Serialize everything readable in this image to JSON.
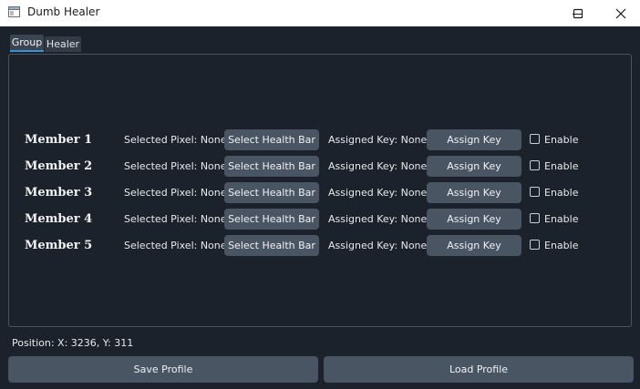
{
  "window": {
    "title": "Dumb Healer",
    "icon": "app-window-icon",
    "controls": [
      "minimize-icon",
      "maximize-icon",
      "close-icon"
    ]
  },
  "tabs": [
    {
      "label": "Group",
      "selected": true
    },
    {
      "label": "Healer",
      "selected": false
    }
  ],
  "members": [
    {
      "label": "Member 1",
      "pixel": "Selected Pixel: None",
      "select_label": "Select Health Bar",
      "key": "Assigned Key: None",
      "assign_label": "Assign Key",
      "enable_label": "Enable",
      "enabled": false
    },
    {
      "label": "Member 2",
      "pixel": "Selected Pixel: None",
      "select_label": "Select Health Bar",
      "key": "Assigned Key: None",
      "assign_label": "Assign Key",
      "enable_label": "Enable",
      "enabled": false
    },
    {
      "label": "Member 3",
      "pixel": "Selected Pixel: None",
      "select_label": "Select Health Bar",
      "key": "Assigned Key: None",
      "assign_label": "Assign Key",
      "enable_label": "Enable",
      "enabled": false
    },
    {
      "label": "Member 4",
      "pixel": "Selected Pixel: None",
      "select_label": "Select Health Bar",
      "key": "Assigned Key: None",
      "assign_label": "Assign Key",
      "enable_label": "Enable",
      "enabled": false
    },
    {
      "label": "Member 5",
      "pixel": "Selected Pixel: None",
      "select_label": "Select Health Bar",
      "key": "Assigned Key: None",
      "assign_label": "Assign Key",
      "enable_label": "Enable",
      "enabled": false
    }
  ],
  "status": {
    "position": "Position: X: 3236, Y: 311"
  },
  "footer": {
    "save_label": "Save Profile",
    "load_label": "Load Profile"
  },
  "colors": {
    "background": "#1b222b",
    "button": "#4a5563",
    "tab_accent": "#3d8fd6",
    "titlebar": "#ffffff"
  }
}
